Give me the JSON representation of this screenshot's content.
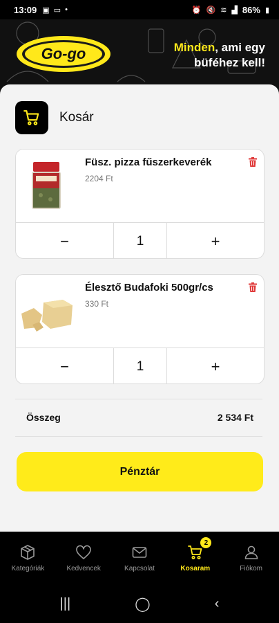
{
  "status_bar": {
    "time": "13:09",
    "battery": "86%"
  },
  "header": {
    "logo_text": "Go-go",
    "slogan_highlight": "Minden",
    "slogan_rest_line1": ", ami egy",
    "slogan_line2": "büféhez kell!"
  },
  "page": {
    "title": "Kosár"
  },
  "cart_items": [
    {
      "name": "Füsz. pizza fűszerkeverék",
      "price": "2204 Ft",
      "quantity": "1",
      "minus": "−",
      "plus": "+"
    },
    {
      "name": "Élesztő Budafoki 500gr/cs",
      "price": "330 Ft",
      "quantity": "1",
      "minus": "−",
      "plus": "+"
    }
  ],
  "summary": {
    "label": "Összeg",
    "value": "2 534 Ft"
  },
  "checkout_label": "Pénztár",
  "bottom_nav": {
    "items": [
      {
        "label": "Kategóriák",
        "icon": "box-icon"
      },
      {
        "label": "Kedvencek",
        "icon": "heart-icon"
      },
      {
        "label": "Kapcsolat",
        "icon": "mail-icon"
      },
      {
        "label": "Kosaram",
        "icon": "cart-icon",
        "badge": "2"
      },
      {
        "label": "Fiókom",
        "icon": "user-icon"
      }
    ]
  },
  "colors": {
    "accent": "#ffeb1a",
    "background": "#f3f3f3",
    "dark": "#000000"
  }
}
